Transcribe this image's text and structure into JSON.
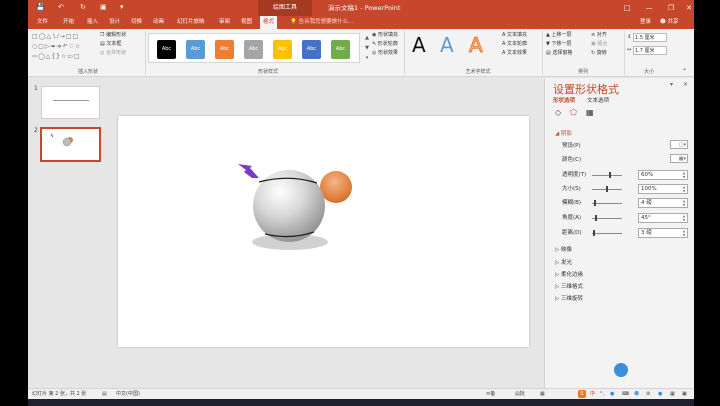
{
  "titlebar": {
    "context_tab": "绘图工具",
    "doc_title": "演示文稿1 - PowerPoint"
  },
  "tabs": [
    {
      "label": "文件",
      "active": false
    },
    {
      "label": "开始",
      "active": false
    },
    {
      "label": "插入",
      "active": false
    },
    {
      "label": "设计",
      "active": false
    },
    {
      "label": "切换",
      "active": false
    },
    {
      "label": "动画",
      "active": false
    },
    {
      "label": "幻灯片放映",
      "active": false
    },
    {
      "label": "审阅",
      "active": false
    },
    {
      "label": "视图",
      "active": false
    },
    {
      "label": "格式",
      "active": true
    }
  ],
  "tell_me": "告诉我您想要做什么...",
  "user": {
    "login": "登录",
    "share": "共享"
  },
  "ribbon": {
    "insert_shapes": {
      "edit_shape": "编辑形状",
      "text_box": "文本框",
      "merge_shapes": "合并形状",
      "label": "插入形状"
    },
    "shape_styles": {
      "buttons": [
        {
          "label": "Abc",
          "color": "#000000"
        },
        {
          "label": "Abc",
          "color": "#5b9bd5"
        },
        {
          "label": "Abc",
          "color": "#ed7d31"
        },
        {
          "label": "Abc",
          "color": "#a5a5a5"
        },
        {
          "label": "Abc",
          "color": "#ffc000"
        },
        {
          "label": "Abc",
          "color": "#4472c4"
        },
        {
          "label": "Abc",
          "color": "#70ad47"
        }
      ],
      "fill": "形状填充",
      "outline": "形状轮廓",
      "effects": "形状效果",
      "label": "形状样式"
    },
    "wordart": {
      "letter": "A",
      "fill": "文本填充",
      "outline": "文本轮廓",
      "effects": "文本效果",
      "label": "艺术字样式"
    },
    "arrange": {
      "forward": "上移一层",
      "backward": "下移一层",
      "pane": "选择窗格",
      "align": "对齐",
      "group": "组合",
      "rotate": "旋转",
      "label": "排列"
    },
    "size": {
      "height": "1.5 厘米",
      "width": "1.7 厘米",
      "label": "大小"
    }
  },
  "slides": [
    {
      "number": "1",
      "selected": false
    },
    {
      "number": "2",
      "selected": true
    }
  ],
  "pane": {
    "title": "设置形状格式",
    "tab_shape": "形状选项",
    "tab_text": "文本选项",
    "section_shadow": "阴影",
    "rows": {
      "preset": "预设(P)",
      "color": "颜色(C)",
      "transparency": {
        "label": "透明度(T)",
        "value": "60%",
        "fraction": 0.6
      },
      "size": {
        "label": "大小(S)",
        "value": "100%",
        "fraction": 0.5
      },
      "blur": {
        "label": "模糊(B)",
        "value": "4 磅",
        "fraction": 0.1
      },
      "angle": {
        "label": "角度(A)",
        "value": "45°",
        "fraction": 0.12
      },
      "distance": {
        "label": "距离(D)",
        "value": "3 磅",
        "fraction": 0.05
      }
    },
    "sections": [
      "映像",
      "发光",
      "柔化边缘",
      "三维格式",
      "三维旋转"
    ]
  },
  "status": {
    "slide_info": "幻灯片 第 2 张，共 2 张",
    "language": "中文(中国)",
    "notes": "备注",
    "comments": "批注"
  },
  "colors": {
    "accent": "#c6472b",
    "orange_ball": "#e0813d",
    "bolt": "#7b3bc2"
  }
}
